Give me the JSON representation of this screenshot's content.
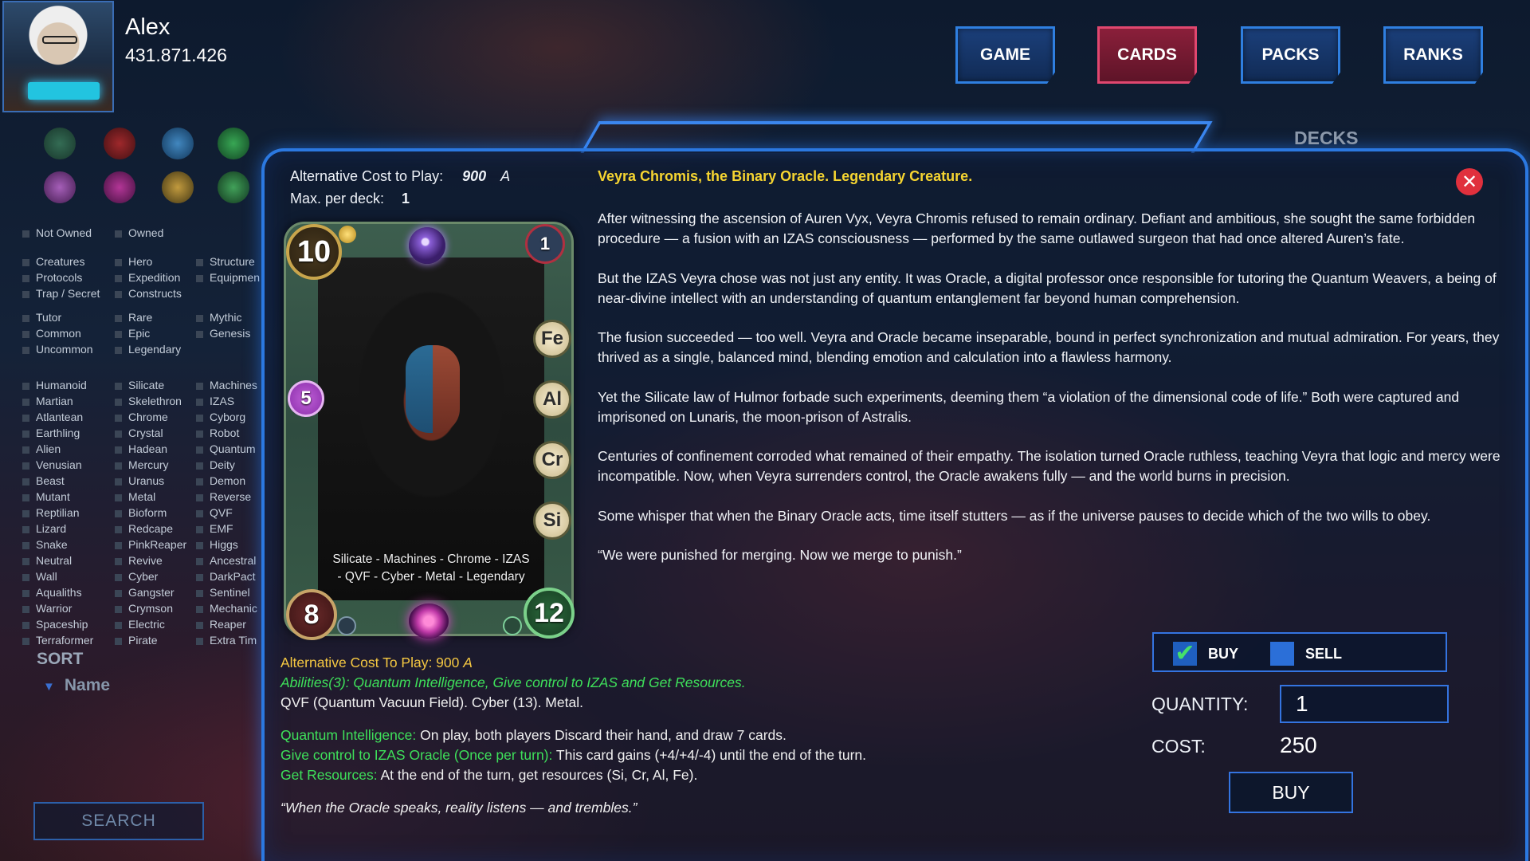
{
  "player": {
    "name": "Alex",
    "coins": "431.871.426"
  },
  "nav": {
    "game": "GAME",
    "cards": "CARDS",
    "packs": "PACKS",
    "ranks": "RANKS"
  },
  "filters": {
    "ownership": [
      "Not Owned",
      "Owned"
    ],
    "types_col1": [
      "Creatures",
      "Protocols",
      "Trap / Secret"
    ],
    "types_col2": [
      "Hero",
      "Expedition",
      "Constructs"
    ],
    "types_col3": [
      "Structure",
      "Equipmen"
    ],
    "rarity_col1": [
      "Tutor",
      "Common",
      "Uncommon"
    ],
    "rarity_col2": [
      "Rare",
      "Epic",
      "Legendary"
    ],
    "rarity_col3": [
      "Mythic",
      "Genesis"
    ],
    "tribes_col1": [
      "Humanoid",
      "Martian",
      "Atlantean",
      "Earthling",
      "Alien",
      "Venusian",
      "Beast",
      "Mutant",
      "Reptilian",
      "Lizard",
      "Snake",
      "Neutral",
      "Wall",
      "Aqualiths",
      "Warrior",
      "Spaceship",
      "Terraformer"
    ],
    "tribes_col2": [
      "Silicate",
      "Skelethron",
      "Chrome",
      "Crystal",
      "Hadean",
      "Mercury",
      "Uranus",
      "Metal",
      "Bioform",
      "Redcape",
      "PinkReaper",
      "Revive",
      "Cyber",
      "Gangster",
      "Crymson",
      "Electric",
      "Pirate"
    ],
    "tribes_col3": [
      "Machines",
      "IZAS",
      "Cyborg",
      "Robot",
      "Quantum",
      "Deity",
      "Demon",
      "Reverse",
      "QVF",
      "EMF",
      "Higgs",
      "Ancestral",
      "DarkPact",
      "Sentinel",
      "Mechanic",
      "Reaper",
      "Extra Tim"
    ]
  },
  "sort": {
    "label": "SORT",
    "name": "Name",
    "search": "SEARCH"
  },
  "decks_label": "DECKS",
  "card": {
    "alt_cost_label": "Alternative Cost to Play:",
    "alt_cost_value": "900",
    "alt_cost_symbol": "A",
    "max_per_deck_label": "Max. per deck:",
    "max_per_deck_value": "1",
    "cost": "10",
    "corner": "1",
    "side_stat": "5",
    "attack": "8",
    "defense": "12",
    "resources": [
      "Fe",
      "Al",
      "Cr",
      "Si"
    ],
    "types_line1": "Silicate - Machines - Chrome - IZAS",
    "types_line2": "- QVF - Cyber - Metal - Legendary"
  },
  "abilities": {
    "alt_cost": "Alternative Cost To Play: 900",
    "alt_symbol": "A",
    "abilities_line": "Abilities(3): Quantum Intelligence, Give control to IZAS and Get Resources.",
    "keywords_line": "QVF (Quantum Vacuun Field). Cyber (13). Metal.",
    "a1_name": "Quantum Intelligence:",
    "a1_text": " On play, both players Discard their hand, and draw 7 cards.",
    "a2_name": "Give control to IZAS Oracle (Once per turn):",
    "a2_text": " This card gains (+4/+4/-4) until the end of the turn.",
    "a3_name": "Get Resources:",
    "a3_text": " At the end of the turn, get resources (Si, Cr, Al, Fe).",
    "quote": "“When the Oracle speaks, reality listens — and trembles.”"
  },
  "lore": {
    "title": "Veyra Chromis, the Binary Oracle. Legendary Creature.",
    "p1": "After witnessing the ascension of Auren Vyx, Veyra Chromis refused to remain ordinary. Defiant and ambitious, she sought the same forbidden procedure — a fusion with an IZAS consciousness — performed by the same outlawed surgeon that had once altered Auren’s fate.",
    "p2": "But the IZAS Veyra chose was not just any entity. It was Oracle, a digital professor once responsible for tutoring the Quantum Weavers, a being of near-divine intellect with an understanding of quantum entanglement far beyond human comprehension.",
    "p3": "The fusion succeeded — too well. Veyra and Oracle became inseparable, bound in perfect synchronization and mutual admiration. For years, they thrived as a single, balanced mind, blending emotion and calculation into a flawless harmony.",
    "p4": "Yet the Silicate law of Hulmor forbade such experiments, deeming them “a violation of the dimensional code of life.” Both were captured and imprisoned on Lunaris, the moon-prison of Astralis.",
    "p5": "Centuries of confinement corroded what remained of their empathy. The isolation turned Oracle ruthless, teaching Veyra that logic and mercy were incompatible. Now, when Veyra surrenders control, the Oracle awakens fully — and the world burns in precision.",
    "p6": "Some whisper that when the Binary Oracle acts, time itself stutters — as if the universe pauses to decide which of the two wills to obey.",
    "p7": "“We were punished for merging. Now we merge to punish.”"
  },
  "trade": {
    "buy_toggle": "BUY",
    "buy_check": "✔",
    "sell_toggle": "SELL",
    "quantity_label": "QUANTITY:",
    "quantity_value": "1",
    "cost_label": "COST:",
    "cost_value": "250",
    "buy_button": "BUY"
  },
  "colors": {
    "accent_blue": "#2b78e0",
    "active_tab": "#e0476f",
    "lore_title": "#f6d531",
    "ability_green": "#3ee05a",
    "alt_cost_yellow": "#f5c842",
    "close_red": "#e0303d"
  }
}
